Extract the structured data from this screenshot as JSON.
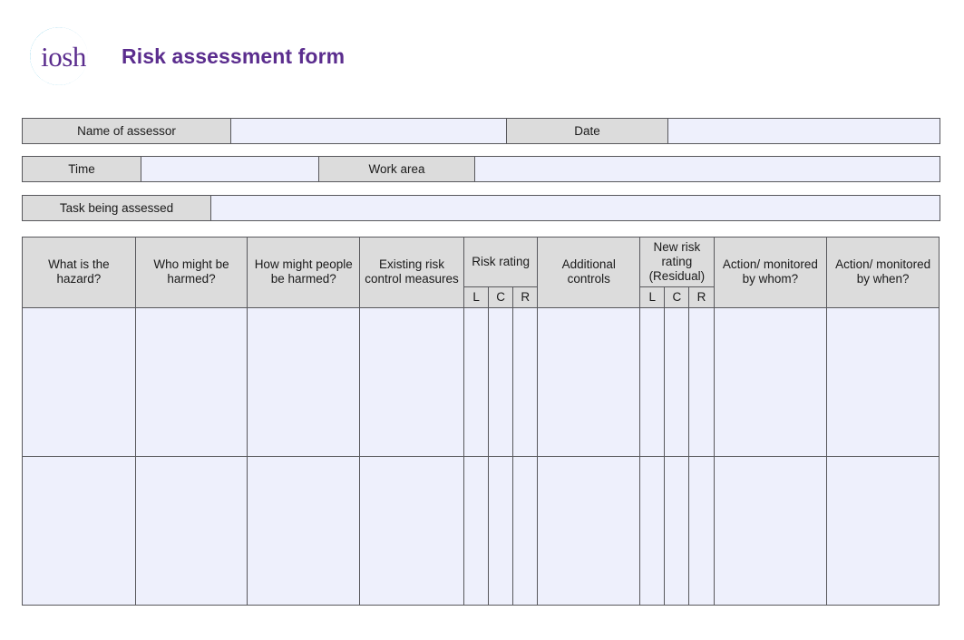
{
  "header": {
    "logo_text": "iosh",
    "logo_icon": "iosh-circle-logo",
    "title": "Risk assessment form",
    "brand_color": "#5b2d8e"
  },
  "colors": {
    "label_background": "#dcdcdc",
    "field_background": "#eef0fc",
    "border": "#58585c",
    "title": "#5b2d8e"
  },
  "info_rows": {
    "name_of_assessor_label": "Name of assessor",
    "name_of_assessor_value": "",
    "date_label": "Date",
    "date_value": "",
    "time_label": "Time",
    "time_value": "",
    "work_area_label": "Work area",
    "work_area_value": "",
    "task_being_assessed_label": "Task being assessed",
    "task_being_assessed_value": ""
  },
  "main_table": {
    "headers": {
      "hazard": "What is the hazard?",
      "who_harmed": "Who might be harmed?",
      "how_harmed": "How might people be harmed?",
      "existing_controls": "Existing risk control measures",
      "risk_rating": "Risk rating",
      "additional_controls": "Additional controls",
      "new_risk_rating": "New risk rating (Residual)",
      "action_by_whom": "Action/ monitored by whom?",
      "action_by_when": "Action/ monitored by when?"
    },
    "subheaders": {
      "l": "L",
      "c": "C",
      "r": "R"
    },
    "rows": [
      {
        "hazard": "",
        "who_harmed": "",
        "how_harmed": "",
        "existing_controls": "",
        "risk_l": "",
        "risk_c": "",
        "risk_r": "",
        "additional_controls": "",
        "new_l": "",
        "new_c": "",
        "new_r": "",
        "action_by_whom": "",
        "action_by_when": ""
      },
      {
        "hazard": "",
        "who_harmed": "",
        "how_harmed": "",
        "existing_controls": "",
        "risk_l": "",
        "risk_c": "",
        "risk_r": "",
        "additional_controls": "",
        "new_l": "",
        "new_c": "",
        "new_r": "",
        "action_by_whom": "",
        "action_by_when": ""
      }
    ]
  }
}
